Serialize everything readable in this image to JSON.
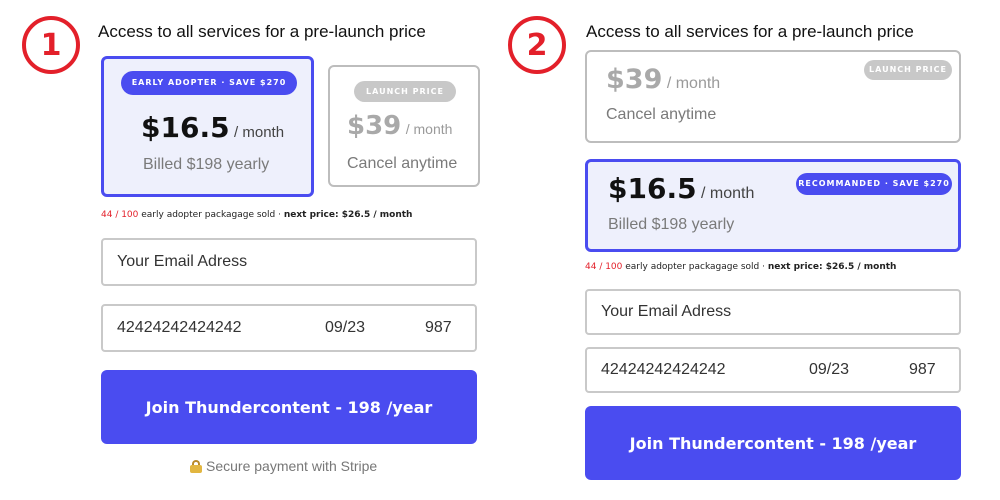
{
  "panels": [
    {
      "number": "1",
      "heading": "Access to all services for a pre-launch price",
      "early_pill": "EARLY ADOPTER · SAVE  $270",
      "early_price": "$16.5",
      "early_unit": "/ month",
      "early_sub": "Billed $198 yearly",
      "launch_pill": "LAUNCH PRICE",
      "launch_price": "$39",
      "launch_unit": "/ month",
      "launch_sub": "Cancel anytime",
      "sold_count": "44 / 100",
      "sold_text": " early adopter packagage sold · ",
      "next_price": "next price: $26.5 / month",
      "email_placeholder": "Your Email Adress",
      "card_number": "42424242424242",
      "card_expiry": "09/23",
      "card_cvc": "987",
      "cta_label": "Join Thundercontent - 198 /year",
      "secure_label": "Secure payment with Stripe"
    },
    {
      "number": "2",
      "heading": "Access to all services for a pre-launch price",
      "launch_pill": "LAUNCH PRICE",
      "launch_price": "$39",
      "launch_unit": "/ month",
      "launch_sub": "Cancel anytime",
      "early_pill": "RECOMMANDED · SAVE  $270",
      "early_price": "$16.5",
      "early_unit": "/ month",
      "early_sub": "Billed $198 yearly",
      "sold_count": "44 / 100",
      "sold_text": " early adopter packagage sold · ",
      "next_price": "next price: $26.5 / month",
      "email_placeholder": "Your Email Adress",
      "card_number": "42424242424242",
      "card_expiry": "09/23",
      "card_cvc": "987",
      "cta_label": "Join Thundercontent - 198 /year"
    }
  ],
  "colors": {
    "accent": "#4a4cf0",
    "badge_red": "#e3202a",
    "active_card_bg": "#eef0fc",
    "inactive_border": "#bdbdbd"
  },
  "icons": {
    "lock": "lock-icon"
  }
}
